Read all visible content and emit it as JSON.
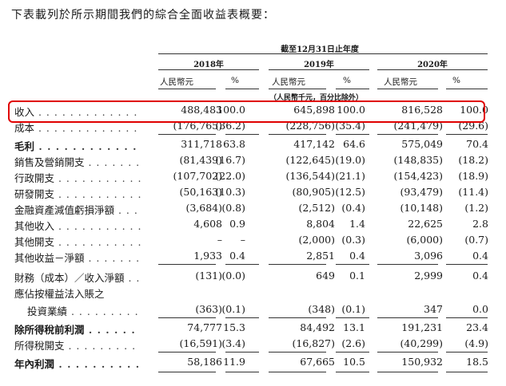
{
  "intro": "下表載列於所示期間我們的綜合全面收益表概要：",
  "period_header": "截至12月31日止年度",
  "years": [
    "2018年",
    "2019年",
    "2020年"
  ],
  "unit_label": "人民幣元",
  "pct_label": "%",
  "unit_note": "（人民幣千元，百分比除外）",
  "rows": [
    {
      "label": "收入",
      "v": [
        "488,483",
        "100.0",
        "645,898",
        "100.0",
        "816,528",
        "100.0"
      ]
    },
    {
      "label": "成本",
      "v": [
        "(176,765)",
        "(36.2)",
        "(228,756)",
        "(35.4)",
        "(241,479)",
        "(29.6)"
      ]
    },
    {
      "label": "毛利",
      "v": [
        "311,718",
        "63.8",
        "417,142",
        "64.6",
        "575,049",
        "70.4"
      ]
    },
    {
      "label": "銷售及營銷開支",
      "v": [
        "(81,439)",
        "(16.7)",
        "(122,645)",
        "(19.0)",
        "(148,835)",
        "(18.2)"
      ]
    },
    {
      "label": "行政開支",
      "v": [
        "(107,702)",
        "(22.0)",
        "(136,544)",
        "(21.1)",
        "(154,423)",
        "(18.9)"
      ]
    },
    {
      "label": "研發開支",
      "v": [
        "(50,163)",
        "(10.3)",
        "(80,905)",
        "(12.5)",
        "(93,479)",
        "(11.4)"
      ]
    },
    {
      "label": "金融資產減值虧損淨額",
      "v": [
        "(3,684)",
        "(0.8)",
        "(2,512)",
        "(0.4)",
        "(10,148)",
        "(1.2)"
      ]
    },
    {
      "label": "其他收入",
      "v": [
        "4,608",
        "0.9",
        "8,804",
        "1.4",
        "22,625",
        "2.8"
      ]
    },
    {
      "label": "其他開支",
      "v": [
        "–",
        "–",
        "(2,000)",
        "(0.3)",
        "(6,000)",
        "(0.7)"
      ]
    },
    {
      "label": "其他收益－淨額",
      "v": [
        "1,933",
        "0.4",
        "2,851",
        "0.4",
        "3,096",
        "0.4"
      ]
    },
    {
      "label": "財務（成本）／收入淨額",
      "v": [
        "(131)",
        "(0.0)",
        "649",
        "0.1",
        "2,999",
        "0.4"
      ]
    },
    {
      "label": "應佔按權益法入賬之",
      "v": [
        "",
        "",
        "",
        "",
        "",
        ""
      ]
    },
    {
      "label": "投資業績",
      "v": [
        "(363)",
        "(0.1)",
        "(348)",
        "(0.1)",
        "347",
        "0.0"
      ]
    },
    {
      "label": "除所得稅前利潤",
      "v": [
        "74,777",
        "15.3",
        "84,492",
        "13.1",
        "191,231",
        "23.4"
      ]
    },
    {
      "label": "所得稅開支",
      "v": [
        "(16,591)",
        "(3.4)",
        "(16,827)",
        "(2.6)",
        "(40,299)",
        "(4.9)"
      ]
    },
    {
      "label": "年內利潤",
      "v": [
        "58,186",
        "11.9",
        "67,665",
        "10.5",
        "150,932",
        "18.5"
      ]
    }
  ]
}
